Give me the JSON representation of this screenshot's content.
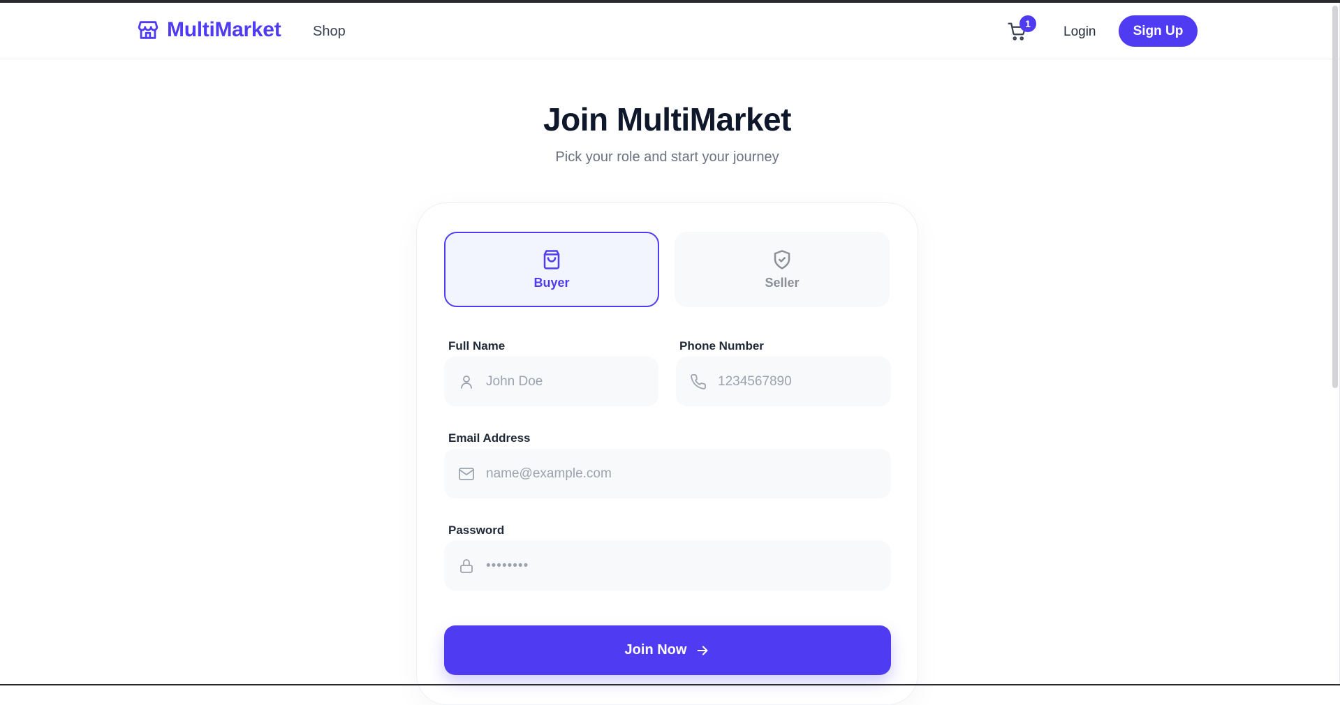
{
  "brand": {
    "name": "MultiMarket",
    "icon": "store-icon",
    "color": "#4f3bf2"
  },
  "nav": {
    "shop_label": "Shop",
    "cart": {
      "icon": "cart-icon",
      "count": "1"
    },
    "login_label": "Login",
    "signup_label": "Sign Up"
  },
  "page": {
    "title": "Join MultiMarket",
    "subtitle": "Pick your role and start your journey"
  },
  "roles": [
    {
      "label": "Buyer",
      "icon": "shopping-bag-icon",
      "selected": true
    },
    {
      "label": "Seller",
      "icon": "shield-check-icon",
      "selected": false
    }
  ],
  "form": {
    "full_name": {
      "label": "Full Name",
      "placeholder": "John Doe",
      "icon": "user-icon",
      "value": ""
    },
    "phone": {
      "label": "Phone Number",
      "placeholder": "1234567890",
      "icon": "phone-icon",
      "value": ""
    },
    "email": {
      "label": "Email Address",
      "placeholder": "name@example.com",
      "icon": "mail-icon",
      "value": ""
    },
    "password": {
      "label": "Password",
      "placeholder": "••••••••",
      "icon": "lock-icon",
      "value": ""
    },
    "submit_label": "Join Now",
    "submit_icon": "arrow-right-icon"
  },
  "colors": {
    "accent": "#4f3bf2",
    "input_bg": "#f8f9fb",
    "selected_role_bg": "#f3f5fe",
    "title": "#0f172a",
    "muted": "#6b7280"
  }
}
